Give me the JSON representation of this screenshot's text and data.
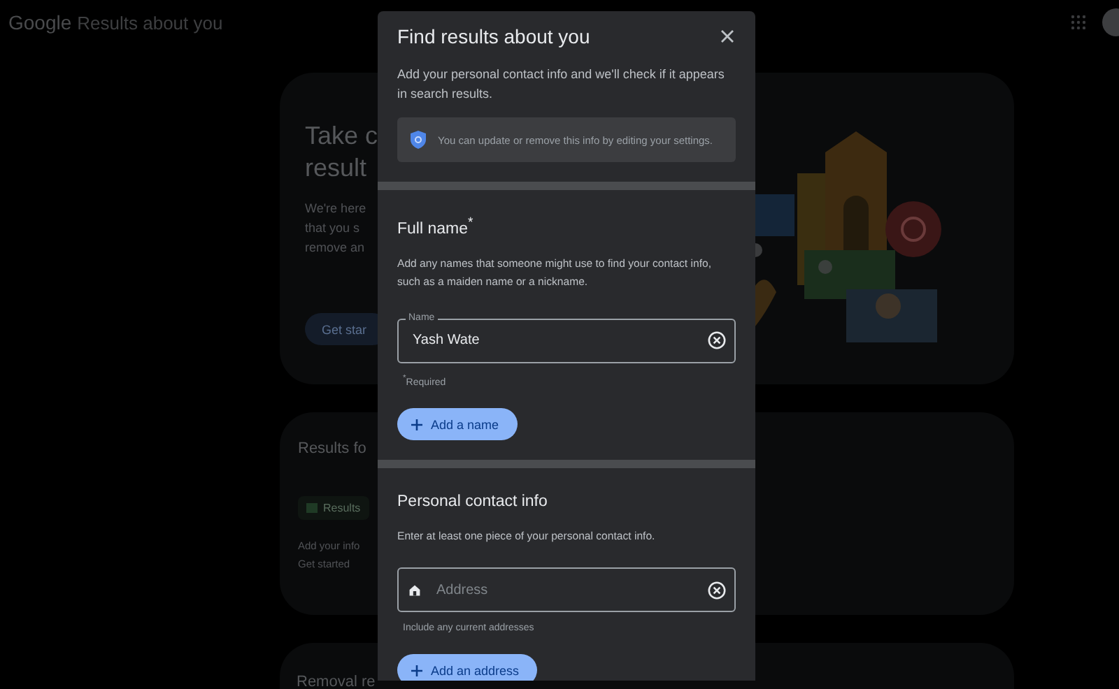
{
  "header": {
    "logo": "Google",
    "title": "Results about you"
  },
  "background": {
    "hero": {
      "heading_lines": [
        "Take c",
        "result"
      ],
      "body_lines": [
        "We're here",
        "that you s",
        "remove an"
      ],
      "button": "Get star"
    },
    "results_card": {
      "title": "Results fo",
      "chip": "Results",
      "lines": [
        "Add your info",
        "Get started"
      ]
    },
    "removal_card": {
      "title": "Removal re"
    }
  },
  "dialog": {
    "title": "Find results about you",
    "intro": "Add your personal contact info and we'll check if it appears in search results.",
    "notice": "You can update or remove this info by editing your settings.",
    "sections": [
      {
        "kind": "name",
        "title": "Full name$^{*}$",
        "description": "Add any names that someone might use to find your contact info, such as a maiden name or a nickname.",
        "field": {
          "label": "Name",
          "value": "Yash Wate"
        },
        "helper": "$^{*}$Required",
        "button": "Add a name"
      },
      {
        "kind": "address",
        "title": "Personal contact info",
        "description": "Enter at least one piece of your personal contact info.",
        "field": {
          "placeholder": "Address"
        },
        "helper": "Include any current addresses",
        "button": "Add an address"
      }
    ]
  }
}
